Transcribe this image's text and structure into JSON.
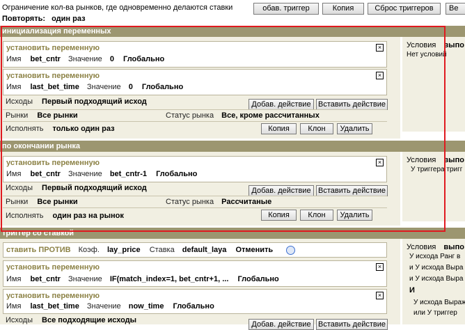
{
  "header": {
    "title": "Ограничение кол-ва рынков, где одновременно делаются ставки",
    "repeat_label": "Повторять:",
    "repeat_value": "один раз",
    "btn_add_trigger": "обав. триггер",
    "btn_copy": "Копия",
    "btn_reset": "Сброс триггеров",
    "btn_ve": "Ве"
  },
  "section1": {
    "title": "инициализация переменных",
    "cards": [
      {
        "title": "установить переменную",
        "name_label": "Имя",
        "name": "bet_cntr",
        "value_label": "Значение",
        "value": "0",
        "scope": "Глобально"
      },
      {
        "title": "установить переменную",
        "name_label": "Имя",
        "name": "last_bet_time",
        "value_label": "Значение",
        "value": "0",
        "scope": "Глобально"
      }
    ],
    "outcomes_label": "Исходы",
    "outcomes": "Первый подходящий исход",
    "markets_label": "Рынки",
    "markets": "Все рынки",
    "status_label": "Статус рынка",
    "status": "Все, кроме рассчитанных",
    "exec_label": "Исполнять",
    "exec": "только один раз",
    "btn_add_action": "Добав. действие",
    "btn_insert_action": "Вставить действие",
    "btn_copy": "Копия",
    "btn_clone": "Клон",
    "btn_delete": "Удалить",
    "cond_label": "Условия",
    "cond_value": "выпо",
    "cond_text": "Нет условий"
  },
  "section2": {
    "title": "по окончании рынка",
    "card": {
      "title": "установить переменную",
      "name_label": "Имя",
      "name": "bet_cntr",
      "value_label": "Значение",
      "value": "bet_cntr-1",
      "scope": "Глобально"
    },
    "outcomes_label": "Исходы",
    "outcomes": "Первый подходящий исход",
    "markets_label": "Рынки",
    "markets": "Все рынки",
    "status_label": "Статус рынка",
    "status": "Рассчитаные",
    "exec_label": "Исполнять",
    "exec": "один раз на рынок",
    "btn_add_action": "Добав. действие",
    "btn_insert_action": "Вставить действие",
    "btn_copy": "Копия",
    "btn_clone": "Клон",
    "btn_delete": "Удалить",
    "cond_label": "Условия",
    "cond_value": "выпо",
    "cond_text": "У триггера тригг"
  },
  "section3": {
    "title": "триггер со ставкой",
    "lay": {
      "title": "ставить ПРОТИВ",
      "coef_label": "Коэф.",
      "coef": "lay_price",
      "stake_label": "Ставка",
      "stake": "default_laya",
      "cancel": "Отменить"
    },
    "cards": [
      {
        "title": "установить переменную",
        "name_label": "Имя",
        "name": "bet_cntr",
        "value_label": "Значение",
        "value": "IF(match_index=1, bet_cntr+1, ...",
        "scope": "Глобально"
      },
      {
        "title": "установить переменную",
        "name_label": "Имя",
        "name": "last_bet_time",
        "value_label": "Значение",
        "value": "now_time",
        "scope": "Глобально"
      }
    ],
    "outcomes_label": "Исходы",
    "outcomes": "Все подходящие исходы",
    "btn_add_action": "Добав. действие",
    "btn_insert_action": "Вставить действие",
    "cond_label": "Условия",
    "cond_value": "выпо",
    "cond_lines": [
      "У исхода Ранг в",
      "и У исхода Выра",
      "и У исхода Выра",
      "И",
      "У исхода Выраж",
      "или У триггер"
    ]
  },
  "colors": {
    "section_bar": "#9c9670",
    "panel": "#f1efe2",
    "action_title": "#8c8246",
    "red_box": "#e0191f"
  }
}
